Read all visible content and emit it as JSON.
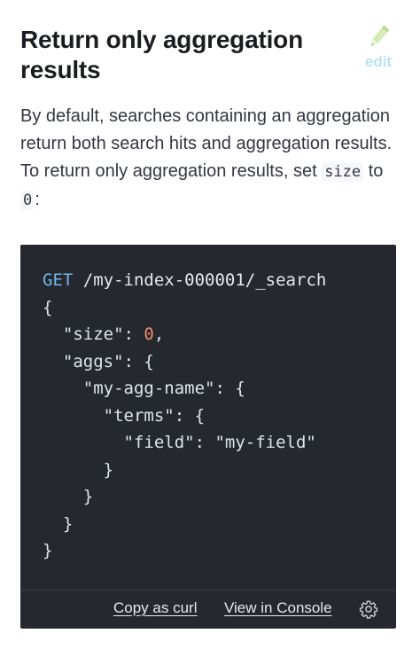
{
  "section": {
    "title": "Return only aggregation results",
    "edit_label": "edit",
    "intro": {
      "text_before": "By default, searches containing an aggregation return both search hits and aggregation results. To return only aggregation results, set ",
      "code_size": "size",
      "text_to": " to ",
      "code_zero": "0",
      "text_after": ":"
    }
  },
  "code": {
    "method": "GET",
    "path": "/my-index-000001/_search",
    "lines": [
      {
        "indent": "",
        "parts": [
          {
            "t": "punct",
            "v": "{"
          }
        ]
      },
      {
        "indent": "  ",
        "parts": [
          {
            "t": "key",
            "v": "\"size\""
          },
          {
            "t": "punct",
            "v": ": "
          },
          {
            "t": "num",
            "v": "0"
          },
          {
            "t": "punct",
            "v": ","
          }
        ]
      },
      {
        "indent": "  ",
        "parts": [
          {
            "t": "key",
            "v": "\"aggs\""
          },
          {
            "t": "punct",
            "v": ": {"
          }
        ]
      },
      {
        "indent": "    ",
        "parts": [
          {
            "t": "key",
            "v": "\"my-agg-name\""
          },
          {
            "t": "punct",
            "v": ": {"
          }
        ]
      },
      {
        "indent": "      ",
        "parts": [
          {
            "t": "key",
            "v": "\"terms\""
          },
          {
            "t": "punct",
            "v": ": {"
          }
        ]
      },
      {
        "indent": "        ",
        "parts": [
          {
            "t": "key",
            "v": "\"field\""
          },
          {
            "t": "punct",
            "v": ": "
          },
          {
            "t": "str",
            "v": "\"my-field\""
          }
        ]
      },
      {
        "indent": "      ",
        "parts": [
          {
            "t": "punct",
            "v": "}"
          }
        ]
      },
      {
        "indent": "    ",
        "parts": [
          {
            "t": "punct",
            "v": "}"
          }
        ]
      },
      {
        "indent": "  ",
        "parts": [
          {
            "t": "punct",
            "v": "}"
          }
        ]
      },
      {
        "indent": "",
        "parts": [
          {
            "t": "punct",
            "v": "}"
          }
        ]
      }
    ],
    "footer": {
      "copy_as_curl": "Copy as curl",
      "view_in_console": "View in Console"
    }
  },
  "icons": {
    "edit": "pencil-icon",
    "settings": "gear-icon"
  },
  "colors": {
    "method": "#6fb6e8",
    "number": "#f08a6e",
    "code_background": "#25282f",
    "edit_link": "#b9e4f0"
  }
}
